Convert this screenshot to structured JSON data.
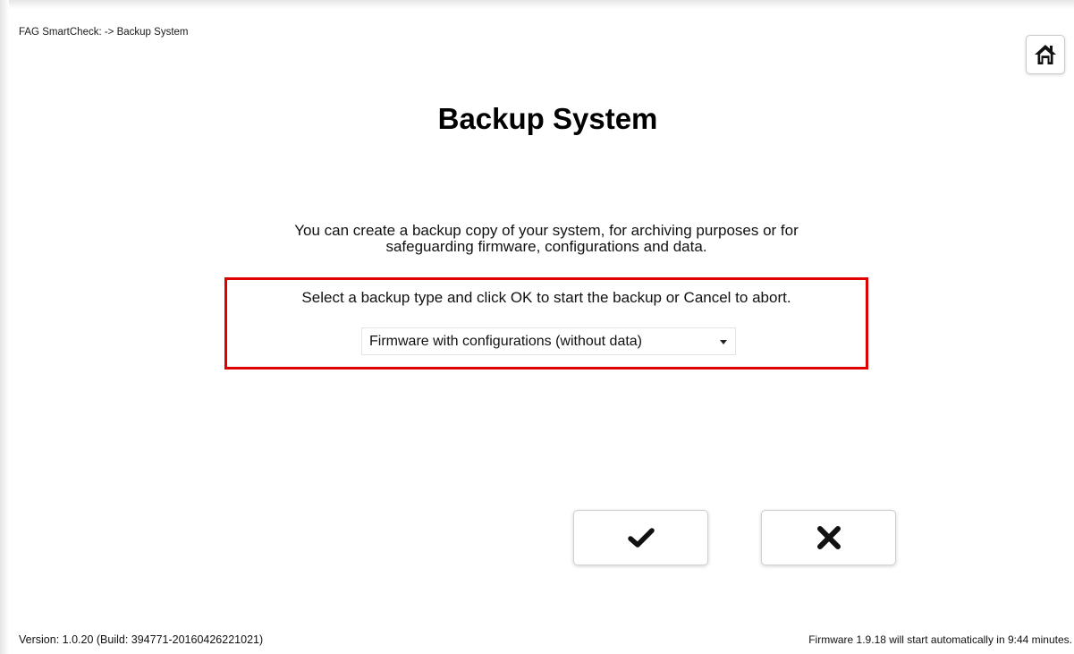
{
  "header": {
    "breadcrumb": "FAG SmartCheck: -> Backup System",
    "home_icon": "home-icon"
  },
  "main": {
    "title": "Backup System",
    "intro_line1": "You can create a backup copy of your system, for archiving purposes or for",
    "intro_line2": "safeguarding firmware, configurations and data.",
    "instruction": "Select a backup type and click OK to start the backup or Cancel to abort.",
    "backup_type": {
      "selected": "Firmware with configurations (without data)"
    },
    "highlight_color": "#e00000"
  },
  "actions": {
    "ok_icon": "checkmark-icon",
    "cancel_icon": "close-icon"
  },
  "footer": {
    "version": "Version: 1.0.20 (Build: 394771-20160426221021)",
    "firmware_notice": "Firmware 1.9.18 will start automatically in 9:44 minutes."
  }
}
